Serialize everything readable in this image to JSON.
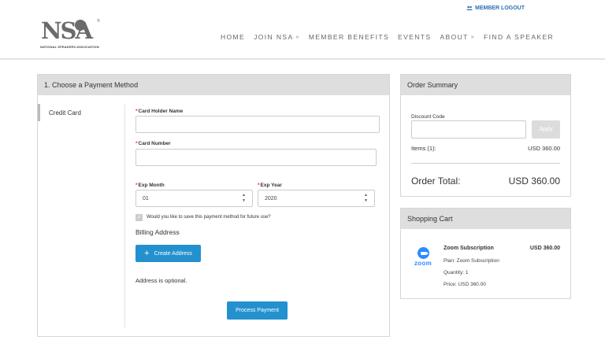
{
  "header": {
    "member_logout": "MEMBER LOGOUT",
    "logo": {
      "letters": "NSA",
      "registered": "®",
      "tagline": "NATIONAL SPEAKERS ASSOCIATION"
    },
    "nav": [
      {
        "label": "HOME",
        "dropdown": false
      },
      {
        "label": "JOIN NSA",
        "dropdown": true
      },
      {
        "label": "MEMBER BENEFITS",
        "dropdown": false
      },
      {
        "label": "EVENTS",
        "dropdown": false
      },
      {
        "label": "ABOUT",
        "dropdown": true
      },
      {
        "label": "FIND A SPEAKER",
        "dropdown": false
      }
    ]
  },
  "payment": {
    "title": "1. Choose a Payment Method",
    "method_tab": "Credit Card",
    "card_holder_label": "Card Holder Name",
    "card_holder_value": "",
    "card_number_label": "Card Number",
    "card_number_value": "",
    "exp_month_label": "Exp Month",
    "exp_month_value": "01",
    "exp_year_label": "Exp Year",
    "exp_year_value": "2020",
    "required_mark": "*",
    "save_method_label": "Would you like to save this payment method for future use?",
    "save_method_checked": true,
    "billing_heading": "Billing Address",
    "create_address_label": "Create Address",
    "address_optional": "Address is optional.",
    "process_label": "Process Payment"
  },
  "summary": {
    "title": "Order Summary",
    "discount_label": "Discount Code",
    "discount_value": "",
    "apply_label": "Apply",
    "items_label": "Items (1):",
    "items_value": "USD 360.00",
    "total_label": "Order Total:",
    "total_value": "USD 360.00"
  },
  "cart": {
    "title": "Shopping Cart",
    "items": [
      {
        "logo_word": "zoom",
        "name": "Zoom Subscription",
        "price": "USD 360.00",
        "plan": "Plan: Zoom Subscription",
        "quantity": "Quantity: 1",
        "unit_price": "Price:  USD 360.00"
      }
    ]
  },
  "colors": {
    "accent": "#2491cf",
    "link": "#2a6fb4",
    "required": "#d9302c",
    "panel_header": "#dedede",
    "zoom": "#2d8cff"
  },
  "icons": {
    "member": "users-icon",
    "plus": "plus-icon",
    "check": "check-icon",
    "spinner": "spinner-arrows-icon",
    "chevron": "chevron-down-icon"
  }
}
